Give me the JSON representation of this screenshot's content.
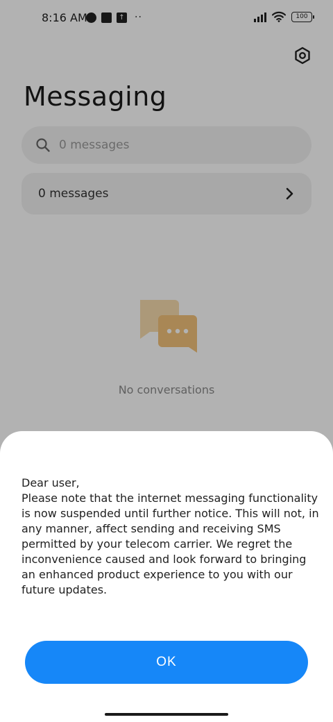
{
  "status_bar": {
    "time": "8:16 AM",
    "battery_level": "100"
  },
  "header": {
    "title": "Messaging"
  },
  "search": {
    "placeholder": "0 messages"
  },
  "messages_row": {
    "label": "0 messages"
  },
  "empty_state": {
    "text": "No conversations"
  },
  "dialog": {
    "message": "Dear user,\nPlease note that the internet messaging functionality is now suspended until further notice. This will not, in any manner, affect sending and receiving SMS permitted by your telecom carrier. We regret the inconvenience caused and look forward to bringing an enhanced product experience to you with our future updates.",
    "ok_label": "OK"
  },
  "colors": {
    "accent": "#1687f8",
    "illustration": "#f2c27a"
  },
  "icons": [
    "settings-icon",
    "search-icon",
    "chevron-right-icon",
    "chat-bubbles-icon",
    "wifi-icon",
    "signal-icon",
    "battery-icon"
  ]
}
